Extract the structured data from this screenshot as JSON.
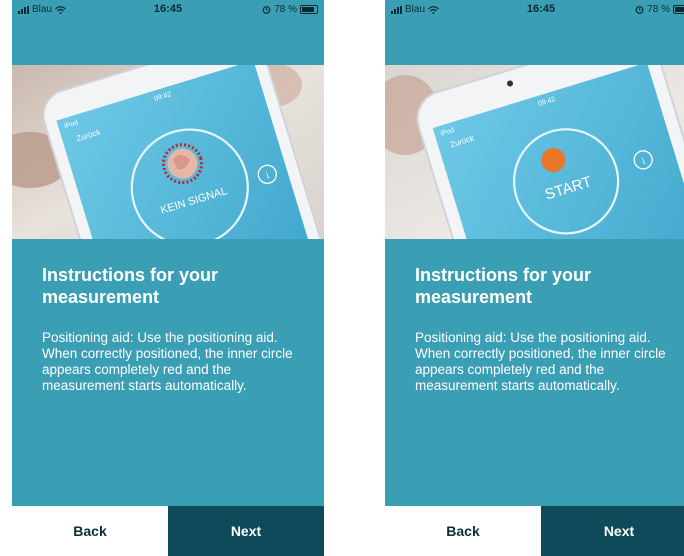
{
  "screens": [
    {
      "status": {
        "carrier": "Blau",
        "time": "16:45",
        "battery": "78 %"
      },
      "photo": {
        "back_label": "Zurück",
        "center_label": "KEIN SIGNAL",
        "info_glyph": "i",
        "clock": "09:42",
        "device": "iPod"
      },
      "title": "Instructions for your measurement",
      "description": "Positioning aid: Use the positioning aid. When correctly positioned, the inner circle appears completely red and the measurement starts automatically.",
      "back_label": "Back",
      "next_label": "Next"
    },
    {
      "status": {
        "carrier": "Blau",
        "time": "16:45",
        "battery": "78 %"
      },
      "photo": {
        "back_label": "Zurück",
        "center_label": "START",
        "info_glyph": "i",
        "clock": "09:42",
        "device": "iPod"
      },
      "title": "Instructions for your measurement",
      "description": "Positioning aid: Use the positioning aid. When correctly positioned, the inner circle appears completely red and the measurement starts automatically.",
      "back_label": "Back",
      "next_label": "Next"
    }
  ],
  "colors": {
    "teal": "#3a9fb5",
    "dark_teal": "#0e4a5a",
    "white": "#ffffff"
  }
}
